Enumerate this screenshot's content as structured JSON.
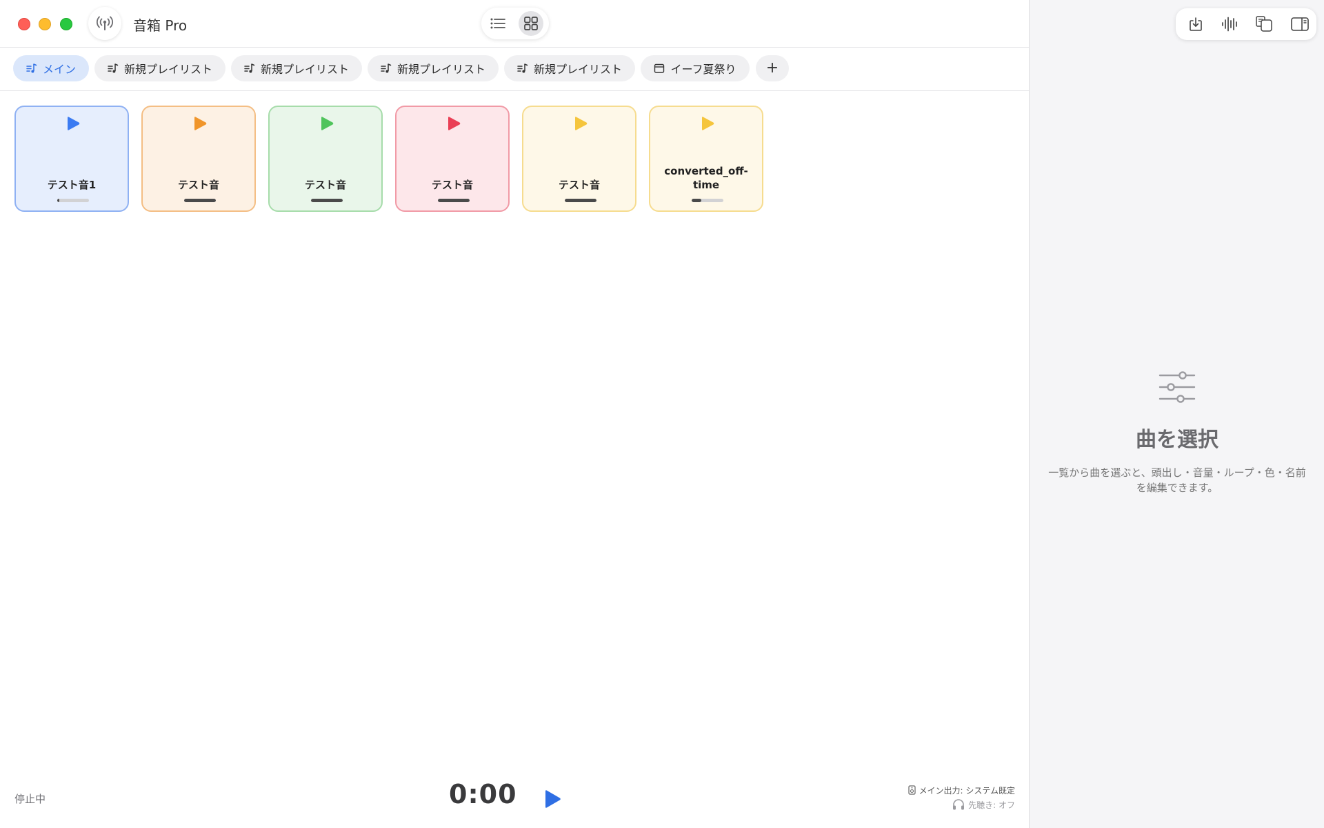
{
  "app": {
    "title": "音箱 Pro",
    "broadcast_icon": "antenna-icon",
    "view_modes": [
      {
        "name": "list",
        "icon": "list-icon",
        "selected": false
      },
      {
        "name": "grid",
        "icon": "grid-icon",
        "selected": true
      }
    ]
  },
  "tabs": [
    {
      "label": "メイン",
      "icon": "playlist-icon",
      "active": true
    },
    {
      "label": "新規プレイリスト",
      "icon": "playlist-icon",
      "active": false
    },
    {
      "label": "新規プレイリスト",
      "icon": "playlist-icon",
      "active": false
    },
    {
      "label": "新規プレイリスト",
      "icon": "playlist-icon",
      "active": false
    },
    {
      "label": "新規プレイリスト",
      "icon": "playlist-icon",
      "active": false
    },
    {
      "label": "イーフ夏祭り",
      "icon": "calendar-icon",
      "active": false
    }
  ],
  "add_tab_label": "+",
  "cards": [
    {
      "name": "テスト音1",
      "color": "#3b7bf2",
      "bg": "#e6eefd",
      "border": "#8fb1f3",
      "progress": 0.05,
      "selected": true
    },
    {
      "name": "テスト音",
      "color": "#f0952a",
      "bg": "#fdf1e4",
      "border": "#f4be84",
      "progress": 1.0,
      "selected": false
    },
    {
      "name": "テスト音",
      "color": "#4fc45c",
      "bg": "#e9f6ea",
      "border": "#a6dcaa",
      "progress": 1.0,
      "selected": false
    },
    {
      "name": "テスト音",
      "color": "#ea3f55",
      "bg": "#fde7ea",
      "border": "#f19aa6",
      "progress": 1.0,
      "selected": false
    },
    {
      "name": "テスト音",
      "color": "#f5c53c",
      "bg": "#fef8e8",
      "border": "#f6dc8f",
      "progress": 1.0,
      "selected": false
    },
    {
      "name": "converted_off-time",
      "color": "#f5c53c",
      "bg": "#fef8e8",
      "border": "#f6dc8f",
      "progress": 0.3,
      "selected": false
    }
  ],
  "footer": {
    "status": "停止中",
    "time": "0:00",
    "output": "メイン出力: システム既定",
    "monitor": "先聴き: オフ",
    "accent": "#2f6fe4"
  },
  "side_panel": {
    "toolbar_icons": [
      "import-icon",
      "waveform-icon",
      "copy-icon",
      "sidebar-toggle-icon"
    ],
    "empty_title": "曲を選択",
    "empty_description": "一覧から曲を選ぶと、頭出し・音量・ループ・色・名前を編集できます。"
  }
}
